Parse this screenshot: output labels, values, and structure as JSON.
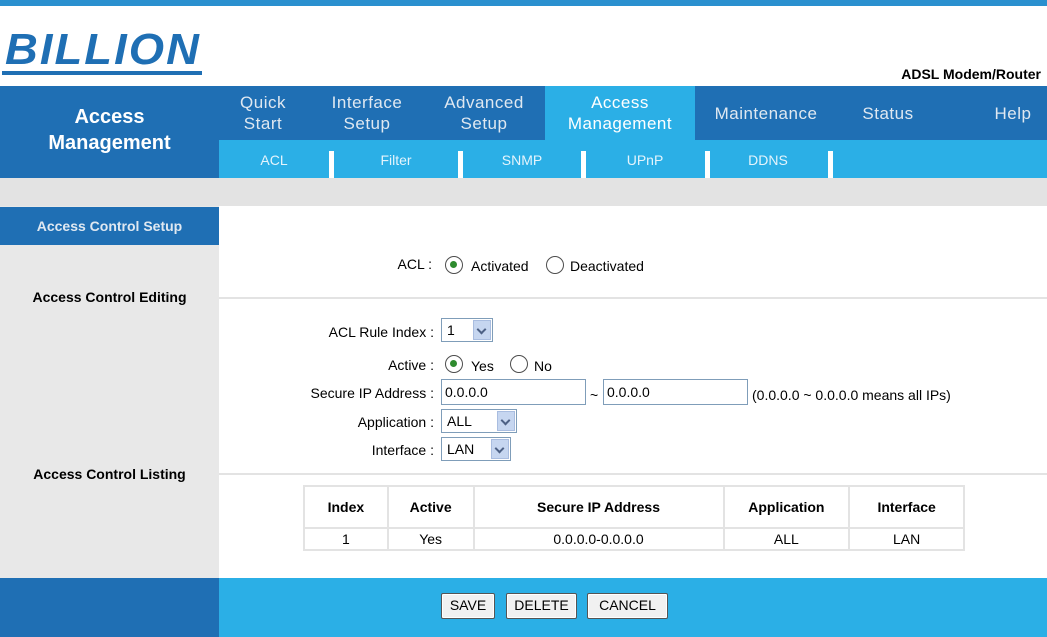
{
  "header": {
    "logo_text": "BILLION",
    "product_name": "ADSL Modem/Router"
  },
  "section": {
    "title_line1": "Access",
    "title_line2": "Management"
  },
  "main_menu": [
    {
      "line1": "Quick",
      "line2": "Start"
    },
    {
      "line1": "Interface",
      "line2": "Setup"
    },
    {
      "line1": "Advanced",
      "line2": "Setup"
    },
    {
      "line1": "Access",
      "line2": "Management",
      "active": true
    },
    {
      "line1": "Maintenance",
      "line2": ""
    },
    {
      "line1": "Status",
      "line2": ""
    },
    {
      "line1": "Help",
      "line2": ""
    }
  ],
  "sub_menu": [
    "ACL",
    "Filter",
    "SNMP",
    "UPnP",
    "DDNS"
  ],
  "left": {
    "setup": "Access Control Setup",
    "editing": "Access Control Editing",
    "listing": "Access Control Listing"
  },
  "acl": {
    "label": "ACL :",
    "activated": "Activated",
    "deactivated": "Deactivated",
    "selected": "Activated"
  },
  "editing": {
    "rule_index_label": "ACL Rule Index :",
    "rule_index_value": "1",
    "active_label": "Active :",
    "active_yes": "Yes",
    "active_no": "No",
    "active_selected": "Yes",
    "secure_ip_label": "Secure IP Address :",
    "ip_start": "0.0.0.0",
    "ip_separator": "~",
    "ip_end": "0.0.0.0",
    "ip_hint": "(0.0.0.0 ~ 0.0.0.0 means all IPs)",
    "application_label": "Application :",
    "application_value": "ALL",
    "interface_label": "Interface :",
    "interface_value": "LAN"
  },
  "table": {
    "headers": [
      "Index",
      "Active",
      "Secure IP Address",
      "Application",
      "Interface"
    ],
    "rows": [
      [
        "1",
        "Yes",
        "0.0.0.0-0.0.0.0",
        "ALL",
        "LAN"
      ]
    ]
  },
  "buttons": {
    "save": "SAVE",
    "delete": "DELETE",
    "cancel": "CANCEL"
  },
  "colors": {
    "navy": "#1f6fb4",
    "cyan": "#2bafe6",
    "gray": "#e3e3e3",
    "radio_dot": "#2e8b2e"
  }
}
